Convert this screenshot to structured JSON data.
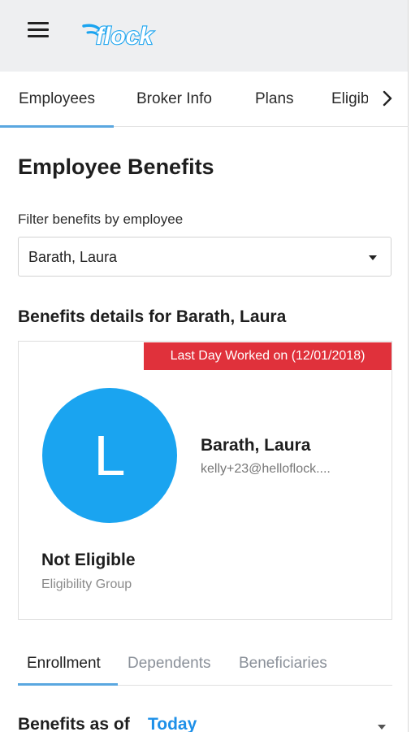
{
  "header": {
    "logo_text": "flock",
    "brand_color": "#1aa4f0"
  },
  "tabs": [
    {
      "label": "Employees",
      "active": true
    },
    {
      "label": "Broker Info",
      "active": false
    },
    {
      "label": "Plans",
      "active": false
    },
    {
      "label": "Eligibility",
      "active": false
    }
  ],
  "page": {
    "title": "Employee Benefits",
    "filter_label": "Filter benefits by employee",
    "filter_value": "Barath, Laura",
    "details_heading": "Benefits details for Barath, Laura"
  },
  "employee": {
    "last_day_badge": "Last Day Worked on (12/01/2018)",
    "avatar_initial": "L",
    "name": "Barath, Laura",
    "email": "kelly+23@helloflock....",
    "eligibility_status": "Not Eligible",
    "eligibility_label": "Eligibility Group"
  },
  "subtabs": [
    {
      "label": "Enrollment",
      "active": true
    },
    {
      "label": "Dependents",
      "active": false
    },
    {
      "label": "Beneficiaries",
      "active": false
    }
  ],
  "benefits": {
    "label": "Benefits as of",
    "date_value": "Today"
  },
  "colors": {
    "accent": "#5aa7e0",
    "badge_red": "#e0313b",
    "link_blue": "#1e90e8"
  }
}
